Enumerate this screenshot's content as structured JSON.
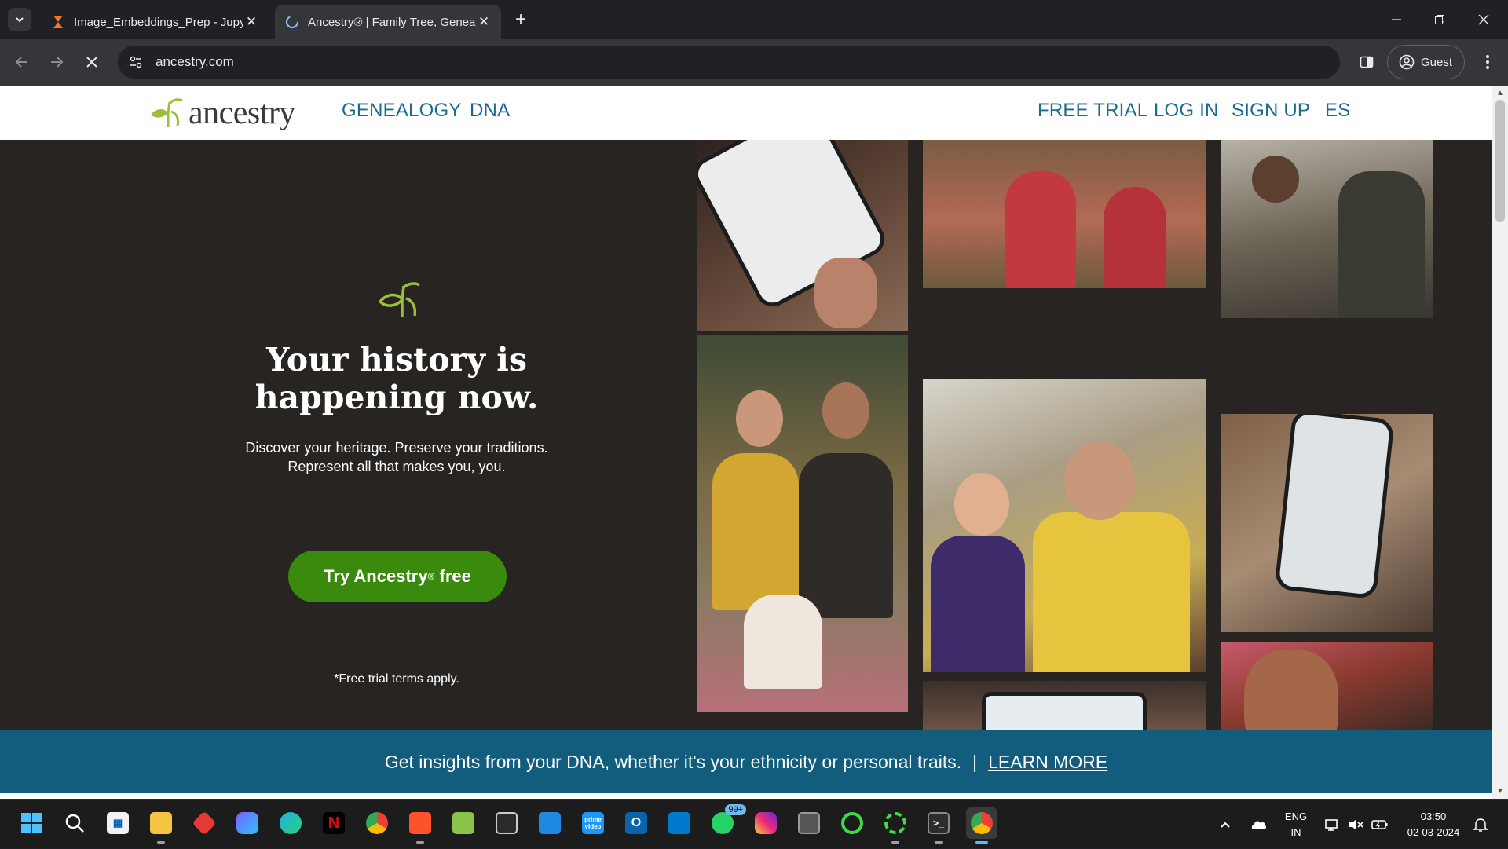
{
  "browser": {
    "tabs": [
      {
        "title": "Image_Embeddings_Prep - Jupy",
        "active": false,
        "icon": "hourglass-icon"
      },
      {
        "title": "Ancestry® | Family Tree, Geneal",
        "active": true,
        "icon": "loading-icon"
      }
    ],
    "url": "ancestry.com",
    "profile_label": "Guest"
  },
  "site": {
    "logo_text": "ancestry",
    "nav_left": [
      "GENEALOGY",
      "DNA"
    ],
    "nav_right": [
      "FREE TRIAL",
      "LOG IN",
      "SIGN UP",
      "ES"
    ],
    "brand_colors": {
      "green": "#3a8a0e",
      "teal": "#125c7e",
      "link": "#1a6b8f",
      "hero_bg": "#272422"
    }
  },
  "hero": {
    "title_line1": "Your history is",
    "title_line2": "happening now.",
    "subtitle_line1": "Discover your heritage. Preserve your traditions.",
    "subtitle_line2": "Represent all that makes you, you.",
    "cta_text": "Try Ancestry",
    "cta_reg": "®",
    "cta_suffix": " free",
    "terms": "*Free trial terms apply."
  },
  "banner": {
    "text": "Get insights from your DNA, whether it's your ethnicity or personal traits.",
    "separator": "|",
    "link": "LEARN MORE"
  },
  "taskbar": {
    "apps": [
      "windows-start",
      "search",
      "microsoft-store",
      "file-explorer",
      "app-red",
      "copilot",
      "edge",
      "netflix",
      "chrome",
      "brave",
      "notepad-plus",
      "terminal-dark",
      "app-blue",
      "prime-video",
      "outlook",
      "vs-code",
      "whatsapp",
      "instagram",
      "app-gray",
      "ring-green",
      "ring-green-2",
      "powershell",
      "chrome-active"
    ],
    "whatsapp_badge": "99+",
    "prime_label": "prime video",
    "lang_line1": "ENG",
    "lang_line2": "IN",
    "time": "03:50",
    "date": "02-03-2024"
  }
}
